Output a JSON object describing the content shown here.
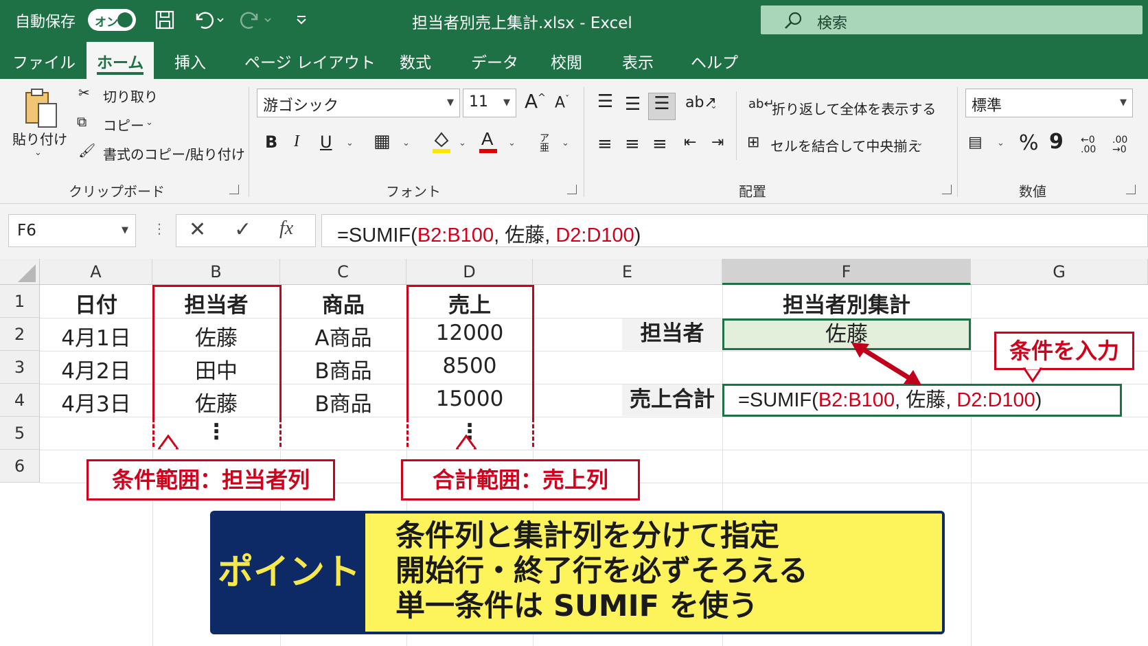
{
  "titlebar": {
    "autosave_label": "自動保存",
    "autosave_toggle": "オン",
    "file_title": "担当者別売上集計.xlsx  -  Excel",
    "search_placeholder": "検索"
  },
  "menu": {
    "tabs": [
      "ファイル",
      "ホーム",
      "挿入",
      "ページ レイアウト",
      "数式",
      "データ",
      "校閲",
      "表示",
      "ヘルプ"
    ],
    "active_tab": "ホーム"
  },
  "ribbon": {
    "clipboard": {
      "paste": "貼り付け",
      "cut": "切り取り",
      "copy": "コピー",
      "format_painter": "書式のコピー/貼り付け",
      "label": "クリップボード"
    },
    "font": {
      "font_name": "游ゴシック",
      "font_size": "11",
      "bold": "B",
      "italic": "I",
      "underline": "U",
      "label": "フォント"
    },
    "alignment": {
      "wrap_text": "折り返して全体を表示する",
      "merge_center": "セルを結合して中央揃え",
      "label": "配置"
    },
    "number": {
      "format": "標準",
      "percent": "%",
      "comma": "9",
      "label": "数値"
    }
  },
  "formula_bar": {
    "name_box": "F6",
    "fx": "fx",
    "formula_prefix": "=SUMIF(",
    "arg1": "B2:B100",
    "sep1": ", 佐藤, ",
    "arg3": "D2:D100",
    "formula_suffix": ")"
  },
  "sheet": {
    "columns": [
      "A",
      "B",
      "C",
      "D",
      "E",
      "F",
      "G"
    ],
    "rows": [
      "1",
      "2",
      "3",
      "4",
      "5",
      "6"
    ],
    "headers": {
      "date": "日付",
      "person": "担当者",
      "product": "商品",
      "sales": "売上"
    },
    "data": [
      {
        "date": "4月1日",
        "person": "佐藤",
        "product": "A商品",
        "sales": "12000"
      },
      {
        "date": "4月2日",
        "person": "田中",
        "product": "B商品",
        "sales": "8500"
      },
      {
        "date": "4月3日",
        "person": "佐藤",
        "product": "B商品",
        "sales": "15000"
      }
    ],
    "ellipsis": "⋮",
    "summary_title": "担当者別集計",
    "person_label": "担当者",
    "person_value": "佐藤",
    "total_label": "売上合計",
    "total_formula_prefix": "=SUMIF(",
    "total_arg1": "B2:B100",
    "total_sep": ", 佐藤, ",
    "total_arg3": "D2:D100",
    "total_suffix": ")"
  },
  "annotations": {
    "criteria_range": "条件範囲：担当者列",
    "sum_range": "合計範囲：売上列",
    "input_condition": "条件を入力"
  },
  "point": {
    "label": "ポイント",
    "lines": [
      "条件列と集計列を分けて指定",
      "開始行・終了行を必ずそろえる",
      "単一条件は SUMIF を使う"
    ]
  },
  "colors": {
    "excel_green": "#1e7145",
    "annotation_red": "#d0021b",
    "point_navy": "#0e2a66",
    "point_yellow": "#fdf35a"
  }
}
